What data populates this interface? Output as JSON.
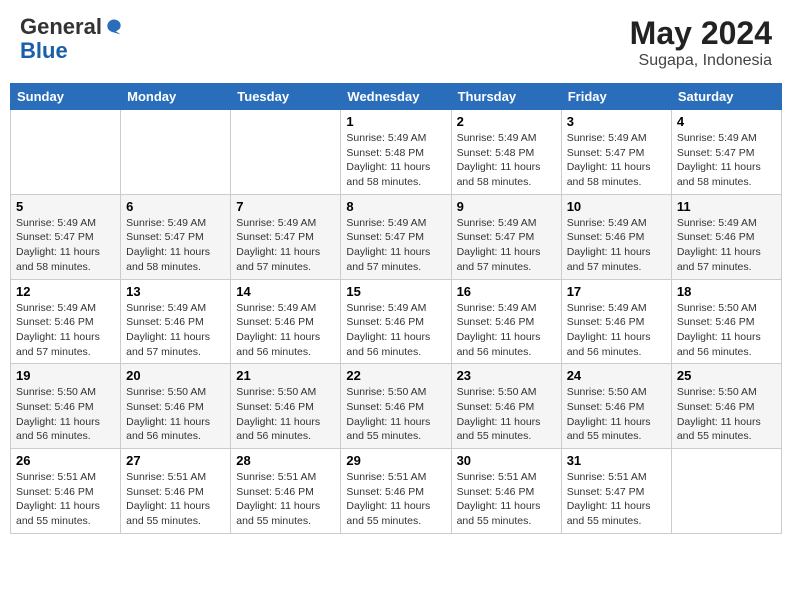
{
  "header": {
    "logo_general": "General",
    "logo_blue": "Blue",
    "month_year": "May 2024",
    "location": "Sugapa, Indonesia"
  },
  "weekdays": [
    "Sunday",
    "Monday",
    "Tuesday",
    "Wednesday",
    "Thursday",
    "Friday",
    "Saturday"
  ],
  "weeks": [
    [
      {
        "day": "",
        "info": ""
      },
      {
        "day": "",
        "info": ""
      },
      {
        "day": "",
        "info": ""
      },
      {
        "day": "1",
        "info": "Sunrise: 5:49 AM\nSunset: 5:48 PM\nDaylight: 11 hours\nand 58 minutes."
      },
      {
        "day": "2",
        "info": "Sunrise: 5:49 AM\nSunset: 5:48 PM\nDaylight: 11 hours\nand 58 minutes."
      },
      {
        "day": "3",
        "info": "Sunrise: 5:49 AM\nSunset: 5:47 PM\nDaylight: 11 hours\nand 58 minutes."
      },
      {
        "day": "4",
        "info": "Sunrise: 5:49 AM\nSunset: 5:47 PM\nDaylight: 11 hours\nand 58 minutes."
      }
    ],
    [
      {
        "day": "5",
        "info": "Sunrise: 5:49 AM\nSunset: 5:47 PM\nDaylight: 11 hours\nand 58 minutes."
      },
      {
        "day": "6",
        "info": "Sunrise: 5:49 AM\nSunset: 5:47 PM\nDaylight: 11 hours\nand 58 minutes."
      },
      {
        "day": "7",
        "info": "Sunrise: 5:49 AM\nSunset: 5:47 PM\nDaylight: 11 hours\nand 57 minutes."
      },
      {
        "day": "8",
        "info": "Sunrise: 5:49 AM\nSunset: 5:47 PM\nDaylight: 11 hours\nand 57 minutes."
      },
      {
        "day": "9",
        "info": "Sunrise: 5:49 AM\nSunset: 5:47 PM\nDaylight: 11 hours\nand 57 minutes."
      },
      {
        "day": "10",
        "info": "Sunrise: 5:49 AM\nSunset: 5:46 PM\nDaylight: 11 hours\nand 57 minutes."
      },
      {
        "day": "11",
        "info": "Sunrise: 5:49 AM\nSunset: 5:46 PM\nDaylight: 11 hours\nand 57 minutes."
      }
    ],
    [
      {
        "day": "12",
        "info": "Sunrise: 5:49 AM\nSunset: 5:46 PM\nDaylight: 11 hours\nand 57 minutes."
      },
      {
        "day": "13",
        "info": "Sunrise: 5:49 AM\nSunset: 5:46 PM\nDaylight: 11 hours\nand 57 minutes."
      },
      {
        "day": "14",
        "info": "Sunrise: 5:49 AM\nSunset: 5:46 PM\nDaylight: 11 hours\nand 56 minutes."
      },
      {
        "day": "15",
        "info": "Sunrise: 5:49 AM\nSunset: 5:46 PM\nDaylight: 11 hours\nand 56 minutes."
      },
      {
        "day": "16",
        "info": "Sunrise: 5:49 AM\nSunset: 5:46 PM\nDaylight: 11 hours\nand 56 minutes."
      },
      {
        "day": "17",
        "info": "Sunrise: 5:49 AM\nSunset: 5:46 PM\nDaylight: 11 hours\nand 56 minutes."
      },
      {
        "day": "18",
        "info": "Sunrise: 5:50 AM\nSunset: 5:46 PM\nDaylight: 11 hours\nand 56 minutes."
      }
    ],
    [
      {
        "day": "19",
        "info": "Sunrise: 5:50 AM\nSunset: 5:46 PM\nDaylight: 11 hours\nand 56 minutes."
      },
      {
        "day": "20",
        "info": "Sunrise: 5:50 AM\nSunset: 5:46 PM\nDaylight: 11 hours\nand 56 minutes."
      },
      {
        "day": "21",
        "info": "Sunrise: 5:50 AM\nSunset: 5:46 PM\nDaylight: 11 hours\nand 56 minutes."
      },
      {
        "day": "22",
        "info": "Sunrise: 5:50 AM\nSunset: 5:46 PM\nDaylight: 11 hours\nand 55 minutes."
      },
      {
        "day": "23",
        "info": "Sunrise: 5:50 AM\nSunset: 5:46 PM\nDaylight: 11 hours\nand 55 minutes."
      },
      {
        "day": "24",
        "info": "Sunrise: 5:50 AM\nSunset: 5:46 PM\nDaylight: 11 hours\nand 55 minutes."
      },
      {
        "day": "25",
        "info": "Sunrise: 5:50 AM\nSunset: 5:46 PM\nDaylight: 11 hours\nand 55 minutes."
      }
    ],
    [
      {
        "day": "26",
        "info": "Sunrise: 5:51 AM\nSunset: 5:46 PM\nDaylight: 11 hours\nand 55 minutes."
      },
      {
        "day": "27",
        "info": "Sunrise: 5:51 AM\nSunset: 5:46 PM\nDaylight: 11 hours\nand 55 minutes."
      },
      {
        "day": "28",
        "info": "Sunrise: 5:51 AM\nSunset: 5:46 PM\nDaylight: 11 hours\nand 55 minutes."
      },
      {
        "day": "29",
        "info": "Sunrise: 5:51 AM\nSunset: 5:46 PM\nDaylight: 11 hours\nand 55 minutes."
      },
      {
        "day": "30",
        "info": "Sunrise: 5:51 AM\nSunset: 5:46 PM\nDaylight: 11 hours\nand 55 minutes."
      },
      {
        "day": "31",
        "info": "Sunrise: 5:51 AM\nSunset: 5:47 PM\nDaylight: 11 hours\nand 55 minutes."
      },
      {
        "day": "",
        "info": ""
      }
    ]
  ]
}
